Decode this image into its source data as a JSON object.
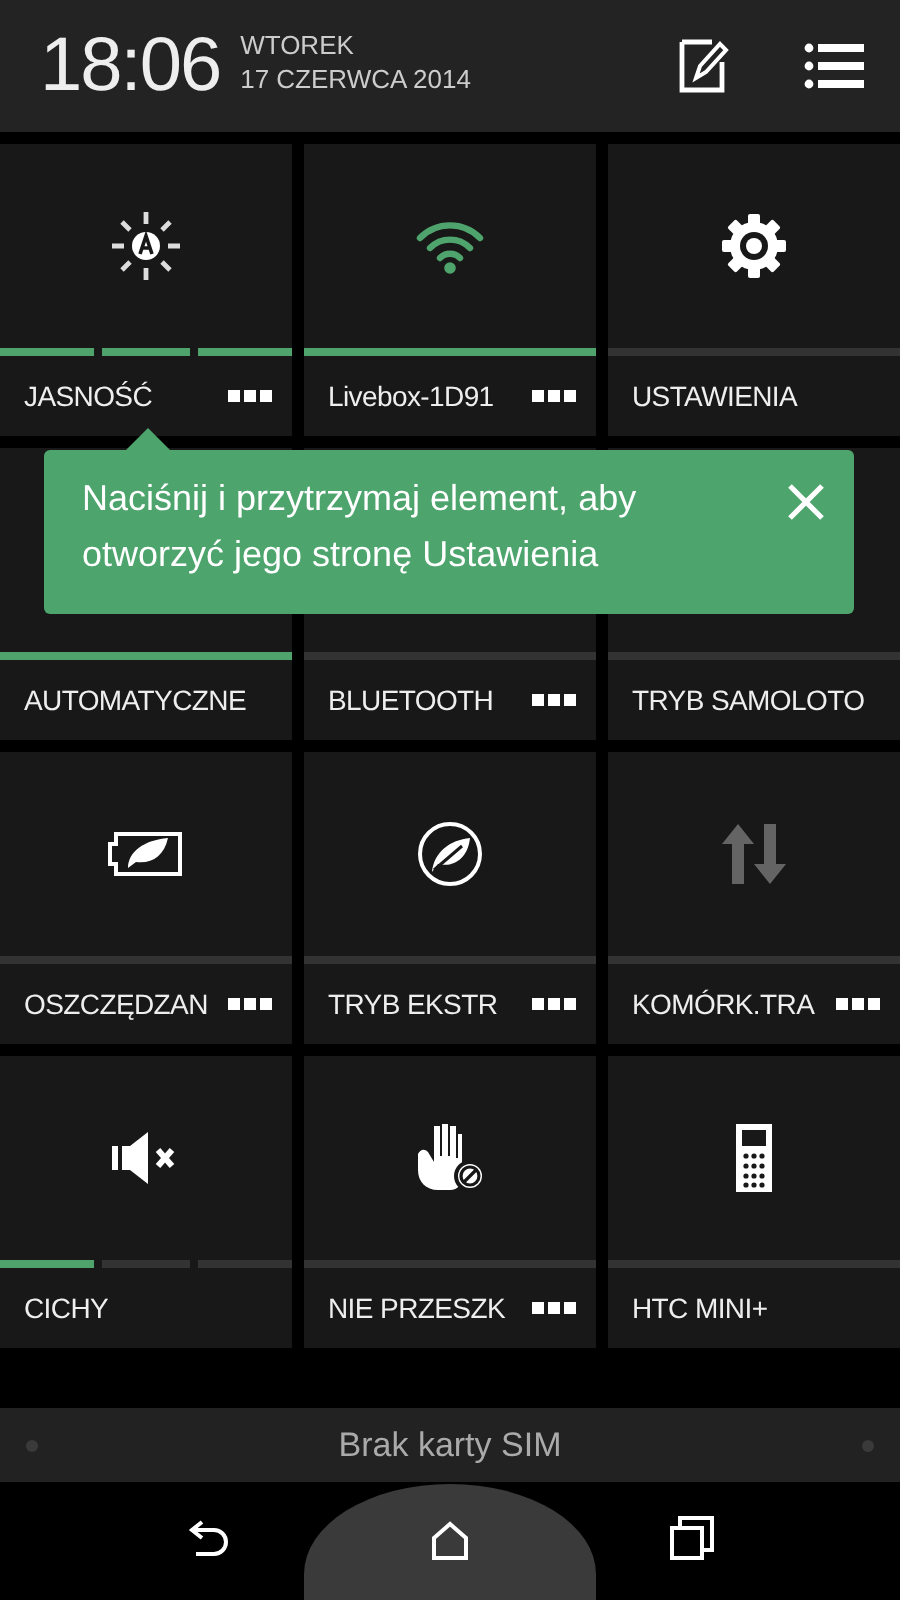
{
  "header": {
    "time": "18:06",
    "day": "WTOREK",
    "date": "17 CZERWCA 2014"
  },
  "tiles": [
    {
      "label": "JASNOŚĆ",
      "kind": "segmented",
      "level": 1,
      "menu": true,
      "disabled": false
    },
    {
      "label": "Livebox-1D91",
      "kind": "toggle",
      "on": true,
      "menu": true,
      "disabled": false
    },
    {
      "label": "USTAWIENIA",
      "kind": "toggle",
      "on": false,
      "menu": false,
      "disabled": false
    },
    {
      "label": "AUTOMATYCZNE",
      "kind": "toggle",
      "on": true,
      "menu": false,
      "disabled": false
    },
    {
      "label": "BLUETOOTH",
      "kind": "toggle",
      "on": false,
      "menu": true,
      "disabled": false
    },
    {
      "label": "TRYB SAMOLOTO",
      "kind": "toggle",
      "on": false,
      "menu": false
    },
    {
      "label": "OSZCZĘDZAN",
      "kind": "toggle",
      "on": false,
      "menu": true,
      "disabled": false
    },
    {
      "label": "TRYB EKSTR",
      "kind": "toggle",
      "on": false,
      "menu": true,
      "disabled": false
    },
    {
      "label": "KOMÓRK.TRA",
      "kind": "toggle",
      "on": false,
      "menu": true,
      "disabled": true
    },
    {
      "label": "CICHY",
      "kind": "segmented",
      "level": 0.33,
      "menu": false,
      "disabled": false
    },
    {
      "label": "NIE PRZESZK",
      "kind": "toggle",
      "on": false,
      "menu": true,
      "disabled": false
    },
    {
      "label": "HTC MINI+",
      "kind": "toggle",
      "on": false,
      "menu": false,
      "disabled": false
    }
  ],
  "tooltip": {
    "text": "Naciśnij i przytrzymaj element, aby otworzyć jego stronę Ustawienia"
  },
  "sim_status": "Brak karty SIM"
}
